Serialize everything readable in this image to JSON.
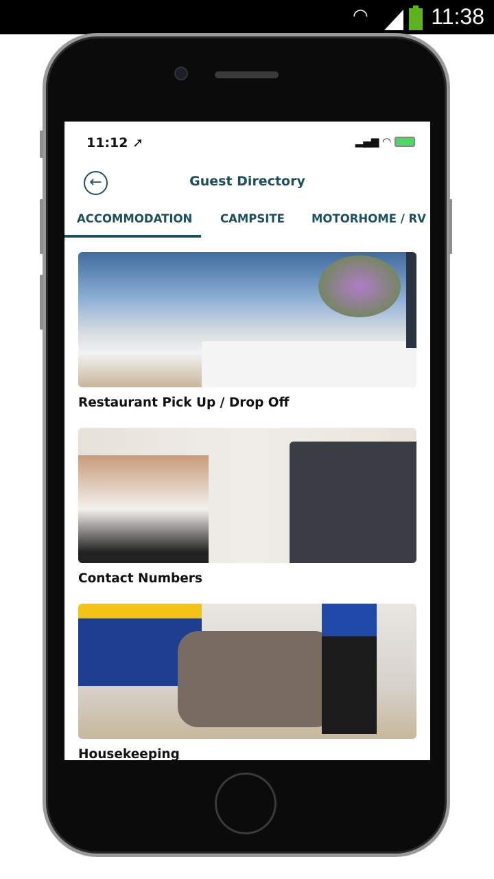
{
  "android_status": {
    "time": "11:38",
    "icons": [
      "wifi-icon",
      "signal-icon",
      "battery-icon"
    ]
  },
  "ios_status": {
    "time": "11:12",
    "icons": [
      "location-arrow-icon",
      "signal-icon",
      "wifi-icon",
      "battery-charging-icon"
    ]
  },
  "header": {
    "title": "Guest Directory",
    "back_icon": "arrow-left-circle-icon"
  },
  "tabs": [
    {
      "label": "ACCOMMODATION",
      "active": true
    },
    {
      "label": "CAMPSITE"
    },
    {
      "label": "MOTORHOME / RV S"
    }
  ],
  "items": [
    {
      "label": "Restaurant Pick Up / Drop Off"
    },
    {
      "label": "Contact Numbers"
    },
    {
      "label": "Housekeeping"
    }
  ],
  "colors": {
    "accent": "#1c4f60"
  }
}
